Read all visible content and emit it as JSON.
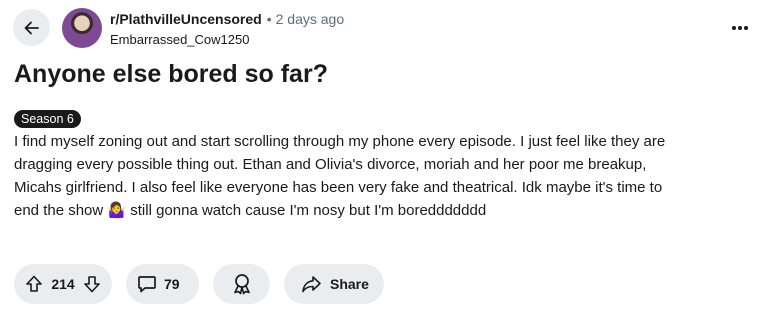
{
  "post": {
    "subreddit": "r/PlathvilleUncensored",
    "separator": "•",
    "time_ago": "2 days ago",
    "author": "Embarrassed_Cow1250",
    "title": "Anyone else bored so far?",
    "flair": "Season 6",
    "body": "I find myself zoning out and start scrolling through my phone every episode. I just feel like they are\ndragging every possible thing out. Ethan and Olivia's divorce, moriah and her poor me breakup,\nMicahs girlfriend. I also feel like everyone has been very fake and theatrical. Idk maybe it's time to\nend the show 🤷‍♀️ still gonna watch cause I'm nosy but I'm boreddddddd"
  },
  "actions": {
    "vote_count": "214",
    "comment_count": "79",
    "share_label": "Share"
  },
  "icons": {
    "back": "arrow-left-icon",
    "more": "ellipsis-icon",
    "upvote": "arrow-up-icon",
    "downvote": "arrow-down-icon",
    "comment": "comment-bubble-icon",
    "award": "award-icon",
    "share": "share-arrow-icon"
  },
  "colors": {
    "pill_background": "#eaedef",
    "text_primary": "#1a1a1b",
    "text_muted": "#576f76",
    "flair_background": "#1a1a1b",
    "flair_text": "#ffffff"
  }
}
